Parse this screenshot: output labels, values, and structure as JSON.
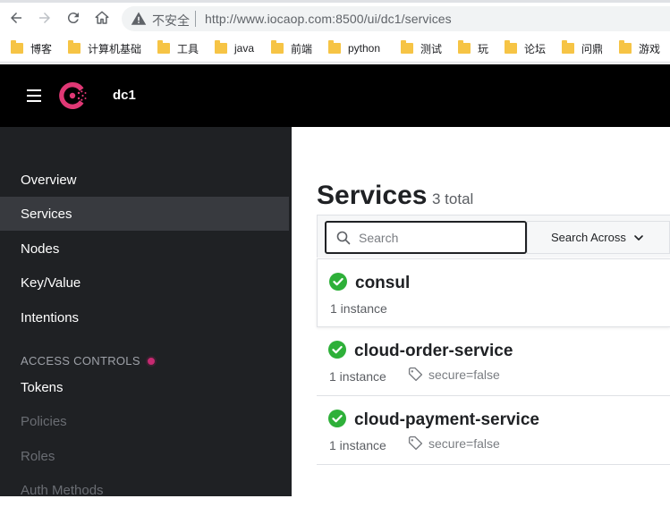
{
  "browser": {
    "insecure_label": "不安全",
    "url": "http://www.iocaop.com:8500/ui/dc1/services",
    "bookmarks": [
      "博客",
      "计算机基础",
      "工具",
      "java",
      "前端",
      "python",
      "测试",
      "玩",
      "论坛",
      "问鼎",
      "游戏"
    ]
  },
  "header": {
    "datacenter": "dc1"
  },
  "sidebar": {
    "items": [
      {
        "label": "Overview"
      },
      {
        "label": "Services"
      },
      {
        "label": "Nodes"
      },
      {
        "label": "Key/Value"
      },
      {
        "label": "Intentions"
      }
    ],
    "section_label": "ACCESS CONTROLS",
    "acl_items": [
      {
        "label": "Tokens"
      },
      {
        "label": "Policies"
      },
      {
        "label": "Roles"
      },
      {
        "label": "Auth Methods"
      }
    ]
  },
  "main": {
    "title": "Services",
    "count": "3 total",
    "search_placeholder": "Search",
    "search_across_label": "Search Across",
    "services": [
      {
        "name": "consul",
        "instances": "1 instance",
        "tag": ""
      },
      {
        "name": "cloud-order-service",
        "instances": "1 instance",
        "tag": "secure=false"
      },
      {
        "name": "cloud-payment-service",
        "instances": "1 instance",
        "tag": "secure=false"
      }
    ]
  },
  "colors": {
    "brand": "#e03875",
    "health_passing": "#2eb039",
    "sidebar_bg": "#1f2124",
    "header_bg": "#000000"
  }
}
